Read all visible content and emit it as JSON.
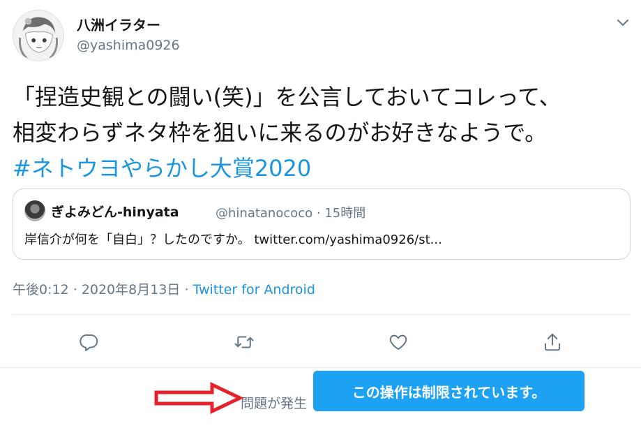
{
  "tweet": {
    "display_name": "八洲イラター",
    "handle": "@yashima0926",
    "text_lines": [
      "「捏造史観との闘い(笑)」を公言しておいてコレって、",
      "相変わらずネタ枠を狙いに来るのがお好きなようで。"
    ],
    "hashtag": "#ネトウヨやらかし大賞2020",
    "timestamp": "午後0:12 · 2020年8月13日 · ",
    "source": "Twitter for Android",
    "link_color": "#1b95e0"
  },
  "quote": {
    "display_name": "ぎよみどん-hinyata",
    "handle_time": "@hinatanococo · 15時間",
    "text": "岸信介が何を「自白」？したのですか。 twitter.com/yashima0926/st..."
  },
  "actions": {
    "reply_icon": "reply-icon",
    "retweet_icon": "retweet-icon",
    "like_icon": "heart-icon",
    "share_icon": "share-icon"
  },
  "footer": {
    "error_text": "問題が発生",
    "toast_text": "この操作は制限されています。",
    "toast_color": "#1da1f2",
    "arrow_color": "#e5222b"
  }
}
